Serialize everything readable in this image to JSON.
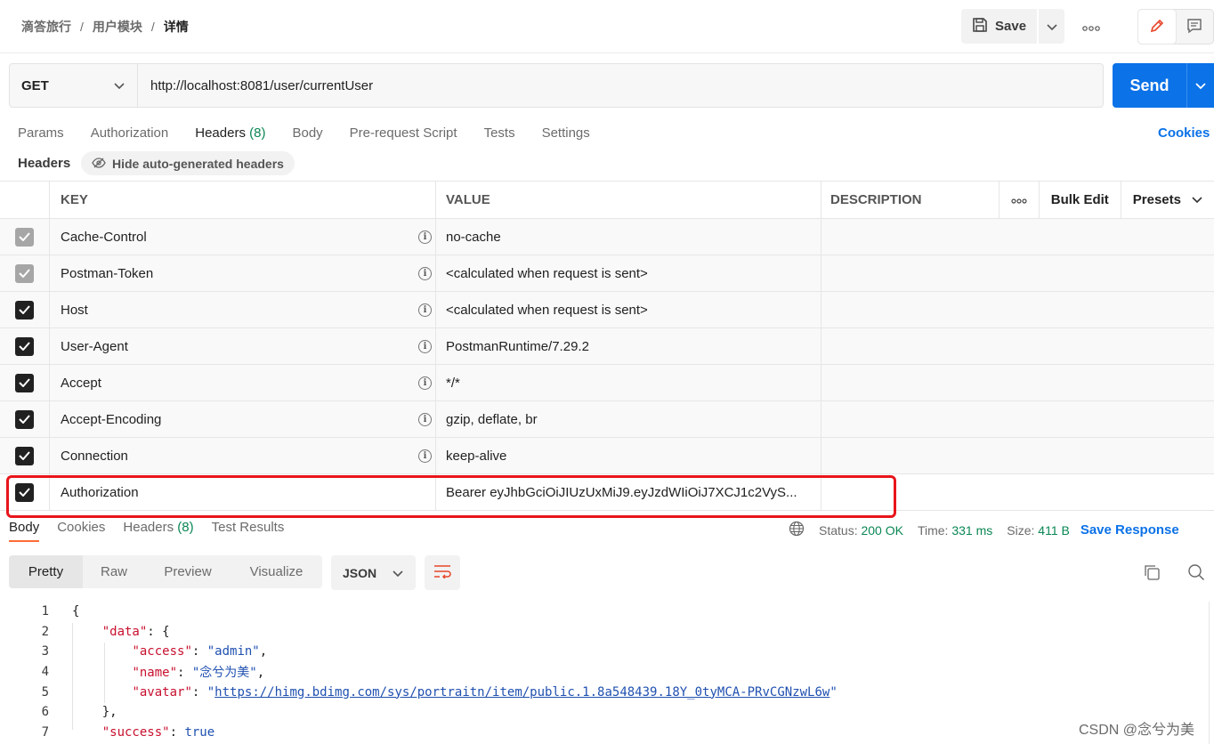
{
  "breadcrumb": {
    "items": [
      "滴答旅行",
      "用户模块",
      "详情"
    ],
    "separator": "/"
  },
  "toolbar": {
    "save_label": "Save",
    "more": "ooo"
  },
  "request": {
    "method": "GET",
    "url": "http://localhost:8081/user/currentUser",
    "send_label": "Send"
  },
  "req_tabs": [
    {
      "label": "Params"
    },
    {
      "label": "Authorization"
    },
    {
      "label": "Headers",
      "count": "(8)"
    },
    {
      "label": "Body"
    },
    {
      "label": "Pre-request Script"
    },
    {
      "label": "Tests"
    },
    {
      "label": "Settings"
    }
  ],
  "cookies_label": "Cookies",
  "headers_section": {
    "title": "Headers",
    "hide_auto_label": "Hide auto-generated headers",
    "columns": {
      "key": "KEY",
      "value": "VALUE",
      "description": "DESCRIPTION",
      "more": "ooo",
      "bulk_edit": "Bulk Edit",
      "presets": "Presets"
    },
    "rows": [
      {
        "key": "Cache-Control",
        "value": "no-cache",
        "checked": "auto"
      },
      {
        "key": "Postman-Token",
        "value": "<calculated when request is sent>",
        "checked": "auto"
      },
      {
        "key": "Host",
        "value": "<calculated when request is sent>",
        "checked": "true"
      },
      {
        "key": "User-Agent",
        "value": "PostmanRuntime/7.29.2",
        "checked": "true"
      },
      {
        "key": "Accept",
        "value": "*/*",
        "checked": "true"
      },
      {
        "key": "Accept-Encoding",
        "value": "gzip, deflate, br",
        "checked": "true"
      },
      {
        "key": "Connection",
        "value": "keep-alive",
        "checked": "true"
      },
      {
        "key": "Authorization",
        "value": "Bearer eyJhbGciOiJIUzUxMiJ9.eyJzdWIiOiJ7XCJ1c2VyS...",
        "checked": "true"
      }
    ]
  },
  "response": {
    "tabs": [
      {
        "label": "Body"
      },
      {
        "label": "Cookies"
      },
      {
        "label": "Headers",
        "count": "(8)"
      },
      {
        "label": "Test Results"
      }
    ],
    "status_label": "Status:",
    "status_value": "200 OK",
    "time_label": "Time:",
    "time_value": "331 ms",
    "size_label": "Size:",
    "size_value": "411 B",
    "save_response_label": "Save Response",
    "view_tabs": [
      "Pretty",
      "Raw",
      "Preview",
      "Visualize"
    ],
    "format": "JSON"
  },
  "code": {
    "line_numbers": [
      "1",
      "2",
      "3",
      "4",
      "5",
      "6",
      "7"
    ],
    "open_brace": "{",
    "data_key": "\"data\"",
    "access_key": "\"access\"",
    "access_val": "\"admin\"",
    "name_key": "\"name\"",
    "name_val": "\"念兮为美\"",
    "avatar_key": "\"avatar\"",
    "avatar_url": "https://himg.bdimg.com/sys/portraitn/item/public.1.8a548439.18Y_0tyMCA-PRvCGNzwL6w",
    "close_inner": "},",
    "success_key": "\"success\"",
    "success_val": "true"
  },
  "watermark": "CSDN @念兮为美",
  "colors": {
    "accent": "#ff6c37",
    "send": "#0b72e7",
    "status_ok": "#0a8754",
    "highlight": "#e8151b"
  }
}
